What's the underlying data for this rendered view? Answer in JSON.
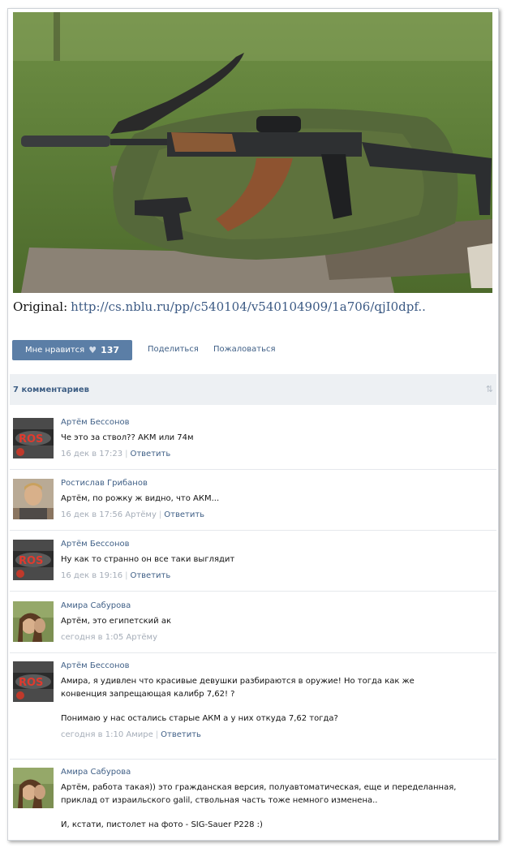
{
  "original": {
    "label": "Original:",
    "url": "http://cs.nblu.ru/pp/c540104/v540104909/1a706/qjI0dpf.."
  },
  "like": {
    "label": "Мне нравится",
    "count": "137"
  },
  "actions": {
    "share": "Поделиться",
    "report": "Пожаловаться"
  },
  "comments_header": {
    "title": "7 комментариев"
  },
  "comments": [
    {
      "author": "Артём Бессонов",
      "lines": [
        "Че это за ствол?? АКМ или 74м"
      ],
      "date": "16 дек в 17:23",
      "reply_to": "",
      "reply": "Ответить",
      "avatar": "ros-logo"
    },
    {
      "author": "Ростислав Грибанов",
      "lines": [
        "Артём, по рожку ж видно, что АКМ..."
      ],
      "date": "16 дек в 17:56 Артёму",
      "reply_to": "",
      "reply": "Ответить",
      "avatar": "man"
    },
    {
      "author": "Артём Бессонов",
      "lines": [
        "Ну как то странно он все таки выглядит"
      ],
      "date": "16 дек в 19:16",
      "reply_to": "",
      "reply": "Ответить",
      "avatar": "ros-logo"
    },
    {
      "author": "Амира Сабурова",
      "lines": [
        "Артём, это египетский ак"
      ],
      "date": "сегодня в 1:05 Артёму",
      "reply_to": "",
      "reply": "",
      "avatar": "woman"
    },
    {
      "author": "Артём Бессонов",
      "lines": [
        "Амира, я удивлен что красивые девушки разбираются в оружие! Но тогда как же",
        "конвенция запрещающая калибр 7,62! ?",
        "",
        "Понимаю у нас остались старые АКМ а у них откуда 7,62 тогда?"
      ],
      "date": "сегодня в 1:10 Амире",
      "reply_to": "",
      "reply": "Ответить",
      "avatar": "ros-logo"
    },
    {
      "author": "Амира Сабурова",
      "lines": [
        "Артём, работа такая)) это гражданская версия, полуавтоматическая, еще и переделанная,",
        "приклад от израильского galil, ствольная часть тоже немного изменена..",
        "",
        "И, кстати, пистолет на фото - SIG-Sauer P228 :)"
      ],
      "date": "",
      "reply_to": "",
      "reply": "",
      "avatar": "woman"
    }
  ],
  "colors": {
    "link": "#3f5f86",
    "button": "#5b7ea6",
    "header_bg": "#edf0f3",
    "meta": "#a5adb8"
  }
}
